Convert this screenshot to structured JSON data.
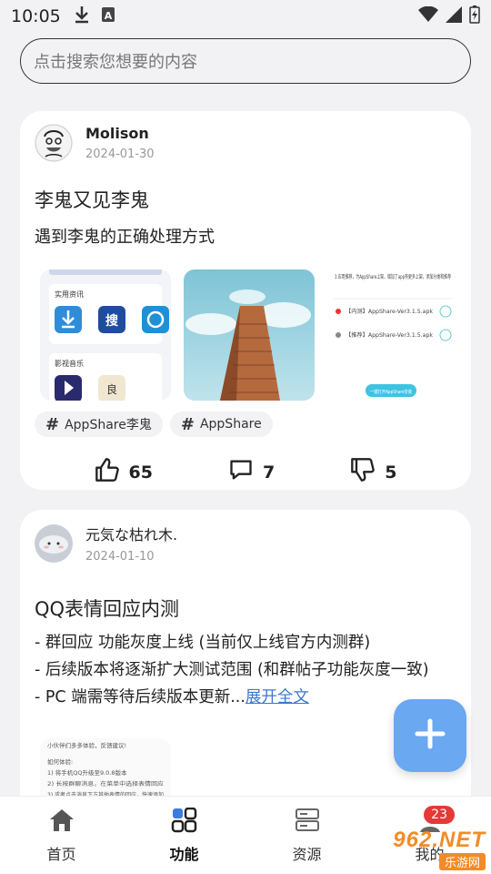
{
  "status_bar": {
    "time": "10:05"
  },
  "search": {
    "placeholder": "点击搜索您想要的内容"
  },
  "posts": [
    {
      "username": "Molison",
      "date": "2024-01-30",
      "title": "李鬼又见李鬼",
      "subtitle": "遇到李鬼的正确处理方式",
      "tags": [
        "AppShare李鬼",
        "AppShare"
      ],
      "likes": "65",
      "comments": "7",
      "dislikes": "5"
    },
    {
      "username": "元気な枯れ木.",
      "date": "2024-01-10",
      "title": "QQ表情回应内测",
      "lines": [
        "- 群回应 功能灰度上线 (当前仅上线官方内测群)",
        "- 后续版本将逐渐扩大测试范围 (和群帖子功能灰度一致)",
        "- PC 端需等待后续版本更新..."
      ],
      "expand": "展开全文"
    }
  ],
  "thumb_text": {
    "t1_a": "实用资讯",
    "t1_b": "影视音乐",
    "t3_a": "3.应用推荐，为AppShare上架，增加了app有更多上架，添加分类和推荐",
    "t3_b": "【内测】AppShare-Ver3.1.5.apk",
    "t3_c": "【推荐】AppShare-Ver3.1.5.apk",
    "t3_d": "一键打开AppShare安装",
    "t4_a": "小伙伴们多多体验，反馈建议!",
    "t4_b": "如何体验:",
    "t4_c": "1) 将手机QQ升级至9.0.8版本",
    "t4_d": "2) 长按群聊消息，在菜单中选择表情回应",
    "t4_e": "3) 或者点击消息下方其他表情的回应，快速添加"
  },
  "bottom_nav": [
    {
      "label": "首页"
    },
    {
      "label": "功能"
    },
    {
      "label": "资源"
    },
    {
      "label": "我的"
    }
  ],
  "badge": "23",
  "watermark": {
    "top": "962.NET",
    "bottom": "乐游网"
  },
  "colors": {
    "accent": "#6aa8f2",
    "link": "#3a78d0",
    "badge": "#e53935"
  }
}
